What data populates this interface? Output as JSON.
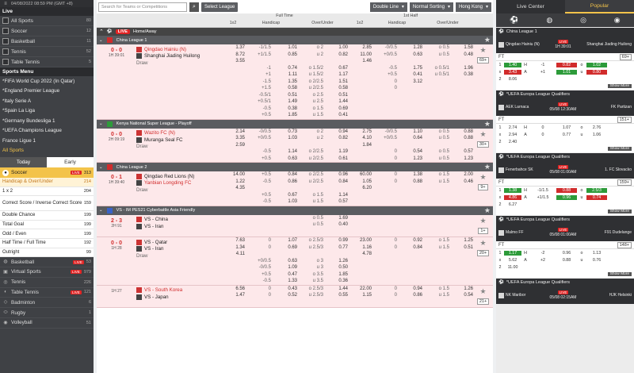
{
  "left": {
    "datetime": "04/08/2022 08:59 PM (GMT +8)",
    "live_title": "Live",
    "live_items": [
      {
        "label": "All Sports",
        "count": "80"
      },
      {
        "label": "Soccer",
        "count": "12"
      },
      {
        "label": "Basketball",
        "count": "11"
      },
      {
        "label": "Tennis",
        "count": "52"
      },
      {
        "label": "Table Tennis",
        "count": "5"
      }
    ],
    "sports_menu_title": "Sports Menu",
    "menu_items": [
      "*FIFA World Cup 2022 (In Qatar)",
      "*England Premier League",
      "*Italy Serie A",
      "*Spain La Liga",
      "*Germany Bundesliga 1",
      "*UEFA Champions League",
      "France Ligue 1",
      "All Sports"
    ],
    "tab_today": "Today",
    "tab_early": "Early",
    "soccer_label": "Soccer",
    "soccer_live": "LIVE",
    "soccer_count": "313",
    "sub_items": [
      {
        "label": "Handicap & Over/Under",
        "count": "214"
      },
      {
        "label": "1 x 2",
        "count": "204"
      },
      {
        "label": "Correct Score / Inverse Correct Score",
        "count": "159"
      },
      {
        "label": "Double Chance",
        "count": "199"
      },
      {
        "label": "Total Goal",
        "count": "199"
      },
      {
        "label": "Odd / Even",
        "count": "199"
      },
      {
        "label": "Half Time / Full Time",
        "count": "192"
      },
      {
        "label": "Outright",
        "count": "99"
      }
    ],
    "other_sports": [
      {
        "label": "Basketball",
        "live": "LIVE",
        "count": "53"
      },
      {
        "label": "Virtual Sports",
        "live": "LIVE",
        "count": "979"
      },
      {
        "label": "Tennis",
        "live": "",
        "count": "226"
      },
      {
        "label": "Table Tennis",
        "live": "LIVE",
        "count": "121"
      },
      {
        "label": "Badminton",
        "live": "",
        "count": "6"
      },
      {
        "label": "Rugby",
        "live": "",
        "count": "1"
      },
      {
        "label": "Volleyball",
        "live": "",
        "count": "51"
      }
    ]
  },
  "center": {
    "search_placeholder": "Search for Teams or Competitions",
    "select_league": "Select League",
    "dd_line": "Double Line",
    "dd_sort": "Normal Sorting",
    "dd_odds": "Hong Kong",
    "full_time": "Full Time",
    "first_half": "1st Half",
    "col_1x2": "1x2",
    "col_handicap": "Handicap",
    "col_ou": "Over/Under",
    "live_btn": "LIVE",
    "home_away": "Home/Away",
    "leagues": [
      {
        "name": "China League 1",
        "flag": "#d12c2c",
        "matches": [
          {
            "score": "0 - 0",
            "time": "1H 39:01",
            "more": "69+",
            "home": "Qingdao Hainiu  (N)",
            "away": "Shanghai Jiading Huilong",
            "draw": "Draw",
            "home_red": true,
            "lines": [
              [
                "1.37",
                "-1/1.5",
                "1.01",
                "o 2",
                "1.00",
                "2.85",
                "-0/0.5",
                "1.28",
                "o 0.5",
                "1.58"
              ],
              [
                "8.72",
                "+1/1.5",
                "0.85",
                "u 2",
                "0.82",
                "11.00",
                "+0/0.5",
                "0.63",
                "u 0.5",
                "0.48"
              ],
              [
                "3.55",
                "",
                "",
                "",
                "",
                "1.46",
                "",
                "",
                "",
                ""
              ],
              [
                "",
                "-1",
                "0.74",
                "o 1.5/2",
                "0.67",
                "",
                "-0.5",
                "1.75",
                "o 0.5/1",
                "1.96"
              ],
              [
                "",
                "+1",
                "1.11",
                "u 1.5/2",
                "1.17",
                "",
                "+0.5",
                "0.41",
                "u 0.5/1",
                "0.38"
              ],
              [
                "",
                "-1.5",
                "1.35",
                "o 2/2.5",
                "1.51",
                "",
                "0",
                "3.12",
                "",
                ""
              ],
              [
                "",
                "+1.5",
                "0.58",
                "u 2/2.5",
                "0.58",
                "",
                "0",
                "",
                "",
                ""
              ],
              [
                "",
                "-0.5/1",
                "0.51",
                "o 2.5",
                "0.51",
                "",
                "",
                "",
                "",
                ""
              ],
              [
                "",
                "+0.5/1",
                "1.49",
                "u 2.5",
                "1.44",
                "",
                "",
                "",
                "",
                ""
              ],
              [
                "",
                "-0.5",
                "0.38",
                "o 1.5",
                "0.69",
                "",
                "",
                "",
                "",
                ""
              ],
              [
                "",
                "+0.5",
                "1.85",
                "u 1.5",
                "0.41",
                "",
                "",
                "",
                "",
                ""
              ]
            ]
          }
        ]
      },
      {
        "name": "Kenya National Super League - Playoff",
        "flag": "#2d9b3a",
        "matches": [
          {
            "score": "0 - 0",
            "time": "2H 09:19",
            "more": "30+",
            "home": "Wazito FC  (N)",
            "away": "Muranga Seal FC",
            "draw": "Draw",
            "home_red": true,
            "lines": [
              [
                "2.14",
                "-0/0.5",
                "0.73",
                "o 2",
                "0.94",
                "2.75",
                "-0/0.5",
                "1.10",
                "o 0.5",
                "0.88"
              ],
              [
                "3.35",
                "+0/0.5",
                "1.03",
                "u 2",
                "0.82",
                "4.10",
                "+0/0.5",
                "0.64",
                "u 0.5",
                "0.88"
              ],
              [
                "2.59",
                "",
                "",
                "",
                "",
                "1.84",
                "",
                "",
                "",
                ""
              ],
              [
                "",
                "-0.5",
                "1.14",
                "o 2/2.5",
                "1.19",
                "",
                "0",
                "0.54",
                "o 0.5",
                "0.57"
              ],
              [
                "",
                "+0.5",
                "0.63",
                "u 2/2.5",
                "0.61",
                "",
                "0",
                "1.23",
                "u 0.5",
                "1.23"
              ]
            ]
          }
        ]
      },
      {
        "name": "China League 2",
        "flag": "#d12c2c",
        "matches": [
          {
            "score": "0 - 1",
            "time": "1H 39:40",
            "more": "9+",
            "home": "Qingdao Red Lions  (N)",
            "away": "Yanbian Longding FC",
            "draw": "Draw",
            "home_red": false,
            "away_orange": true,
            "lines": [
              [
                "14.00",
                "+0.5",
                "0.84",
                "o 2/2.5",
                "0.96",
                "60.00",
                "0",
                "1.38",
                "o 1.5",
                "2.00"
              ],
              [
                "1.22",
                "-0.5",
                "0.86",
                "u 2/2.5",
                "0.84",
                "1.05",
                "0",
                "0.88",
                "u 1.5",
                "0.46"
              ],
              [
                "4.35",
                "",
                "",
                "",
                "",
                "6.20",
                "",
                "",
                "",
                ""
              ],
              [
                "",
                "+0.5",
                "0.67",
                "o 1.5",
                "1.14",
                "",
                "",
                "",
                "",
                ""
              ],
              [
                "",
                "-0.5",
                "1.03",
                "u 1.5",
                "0.57",
                "",
                "",
                "",
                "",
                ""
              ]
            ]
          }
        ]
      },
      {
        "name": "VS - IM PES21 Cyberbattle Asia Friendly",
        "flag": "#3a63c7",
        "matches": [
          {
            "score": "2 - 3",
            "time": "2H 91",
            "more": "1+",
            "home": "VS - China",
            "away": "VS - Iran",
            "draw": "",
            "home_red": false,
            "lines": [
              [
                "",
                "",
                "",
                "o 0.5",
                "1.69",
                "",
                "",
                "",
                "",
                ""
              ],
              [
                "",
                "",
                "",
                "u 0.5",
                "0.40",
                "",
                "",
                "",
                "",
                ""
              ]
            ]
          },
          {
            "score": "0 - 0",
            "time": "1H 28",
            "more": "20+",
            "home": "VS - Qatar",
            "away": "VS - Iran",
            "draw": "Draw",
            "home_red": false,
            "lines": [
              [
                "7.63",
                "0",
                "1.07",
                "o 2.5/3",
                "0.99",
                "23.00",
                "0",
                "0.92",
                "o 1.5",
                "1.25"
              ],
              [
                "1.34",
                "0",
                "0.69",
                "u 2.5/3",
                "0.77",
                "1.16",
                "0",
                "0.84",
                "u 1.5",
                "0.51"
              ],
              [
                "4.11",
                "",
                "",
                "",
                "",
                "4.78",
                "",
                "",
                "",
                ""
              ],
              [
                "",
                "+0/0.5",
                "0.63",
                "o 3",
                "1.26",
                "",
                "",
                "",
                "",
                ""
              ],
              [
                "",
                "-0/0.5",
                "1.09",
                "u 3",
                "0.50",
                "",
                "",
                "",
                "",
                ""
              ],
              [
                "",
                "+0.5",
                "0.47",
                "o 3.5",
                "1.85",
                "",
                "",
                "",
                "",
                ""
              ],
              [
                "",
                "-0.5",
                "1.33",
                "u 3.5",
                "0.36",
                "",
                "",
                "",
                "",
                ""
              ]
            ]
          },
          {
            "score": "",
            "time": "1H 27",
            "more": "21+",
            "home": "VS - South Korea",
            "away": "VS - Japan",
            "draw": "",
            "home_red": true,
            "lines": [
              [
                "6.56",
                "0",
                "0.43",
                "o 2.5/3",
                "1.44",
                "22.00",
                "0",
                "0.94",
                "o 1.5",
                "1.26"
              ],
              [
                "1.47",
                "0",
                "0.52",
                "u 2.5/3",
                "0.55",
                "1.15",
                "0",
                "0.86",
                "u 1.5",
                "0.54"
              ]
            ]
          }
        ]
      }
    ]
  },
  "right": {
    "tab_live": "Live Center",
    "tab_popular": "Popular",
    "cards": [
      {
        "league": "China League 1",
        "live": "LIVE",
        "home": "Qingdao Hainiu (N)",
        "away": "Shanghai Jiading Huilong",
        "date": "1H 39:01",
        "period": "FT",
        "more": "69+",
        "rows": [
          [
            "1",
            "1.40",
            "H",
            "-1",
            "0.82",
            "o",
            "1.02"
          ],
          [
            "x",
            "3.43",
            "A",
            "+1",
            "1.01",
            "u",
            "0.80"
          ],
          [
            "2",
            "8.06",
            "",
            "",
            "",
            "",
            ""
          ]
        ]
      },
      {
        "league": "*UEFA Europa League Qualifiers",
        "live": "LIVE",
        "home": "AEK Larnaca",
        "away": "FK Partizan",
        "date": "05/08 12:30AM",
        "period": "FT",
        "more": "151+",
        "rows": [
          [
            "1",
            "2.74",
            "H",
            "0",
            "1.07",
            "o",
            "2.76"
          ],
          [
            "x",
            "2.94",
            "A",
            "0",
            "0.77",
            "u",
            "1.06"
          ],
          [
            "2",
            "2.40",
            "",
            "",
            "",
            "",
            ""
          ]
        ]
      },
      {
        "league": "*UEFA Europa League Qualifiers",
        "live": "LIVE",
        "home": "Fenerbahce SK",
        "away": "1. FC Slovacko",
        "date": "05/08 01:00AM",
        "period": "FT",
        "more": "159+",
        "rows": [
          [
            "1",
            "1.38",
            "H",
            "-1/1.5",
            "0.88",
            "o",
            "2.5/3"
          ],
          [
            "x",
            "4.86",
            "A",
            "+1/1.5",
            "0.96",
            "u",
            "0.74"
          ],
          [
            "2",
            "6.27",
            "",
            "",
            "",
            "",
            ""
          ]
        ]
      },
      {
        "league": "*UEFA Europa League Qualifiers",
        "live": "LIVE",
        "home": "Malmo FF",
        "away": "F91 Dudelange",
        "date": "05/08 01:00AM",
        "period": "FT",
        "more": "148+",
        "rows": [
          [
            "1",
            "1.17",
            "H",
            "-2",
            "0.96",
            "o",
            "1.13"
          ],
          [
            "x",
            "5.62",
            "A",
            "+2",
            "0.88",
            "u",
            "0.76"
          ],
          [
            "2",
            "11.00",
            "",
            "",
            "",
            "",
            ""
          ]
        ]
      },
      {
        "league": "*UEFA Europa League Qualifiers",
        "live": "LIVE",
        "home": "NK Maribor",
        "away": "HJK Helsinki",
        "date": "05/08 02:15AM",
        "period": "",
        "more": "",
        "rows": []
      }
    ],
    "show_more": "Show More"
  }
}
